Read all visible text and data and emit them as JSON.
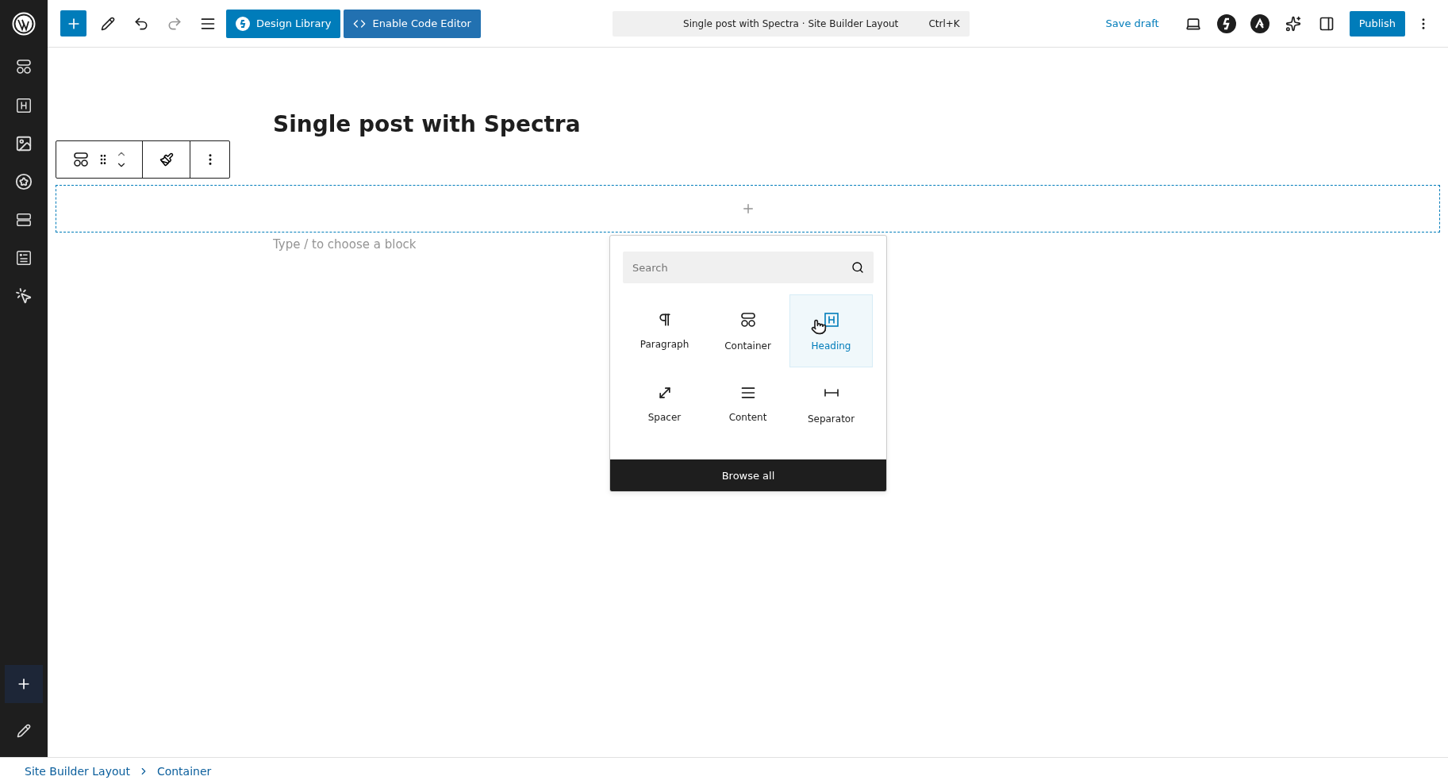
{
  "toolbar": {
    "design_library": "Design Library",
    "code_editor": "Enable Code Editor",
    "command": {
      "title": "Single post with Spectra · Site Builder Layout",
      "shortcut": "Ctrl+K"
    },
    "save_draft": "Save draft",
    "publish": "Publish"
  },
  "editor": {
    "title": "Single post with Spectra",
    "placeholder": "Type / to choose a block"
  },
  "inserter": {
    "search": {
      "placeholder": "Search"
    },
    "blocks": [
      {
        "kind": "paragraph",
        "label": "Paragraph",
        "selected": false
      },
      {
        "kind": "container",
        "label": "Container",
        "selected": false
      },
      {
        "kind": "heading",
        "label": "Heading",
        "selected": true
      },
      {
        "kind": "spacer",
        "label": "Spacer",
        "selected": false
      },
      {
        "kind": "content",
        "label": "Content",
        "selected": false
      },
      {
        "kind": "separator",
        "label": "Separator",
        "selected": false
      }
    ],
    "browse_all": "Browse all"
  },
  "breadcrumb": [
    "Site Builder Layout",
    "Container"
  ]
}
